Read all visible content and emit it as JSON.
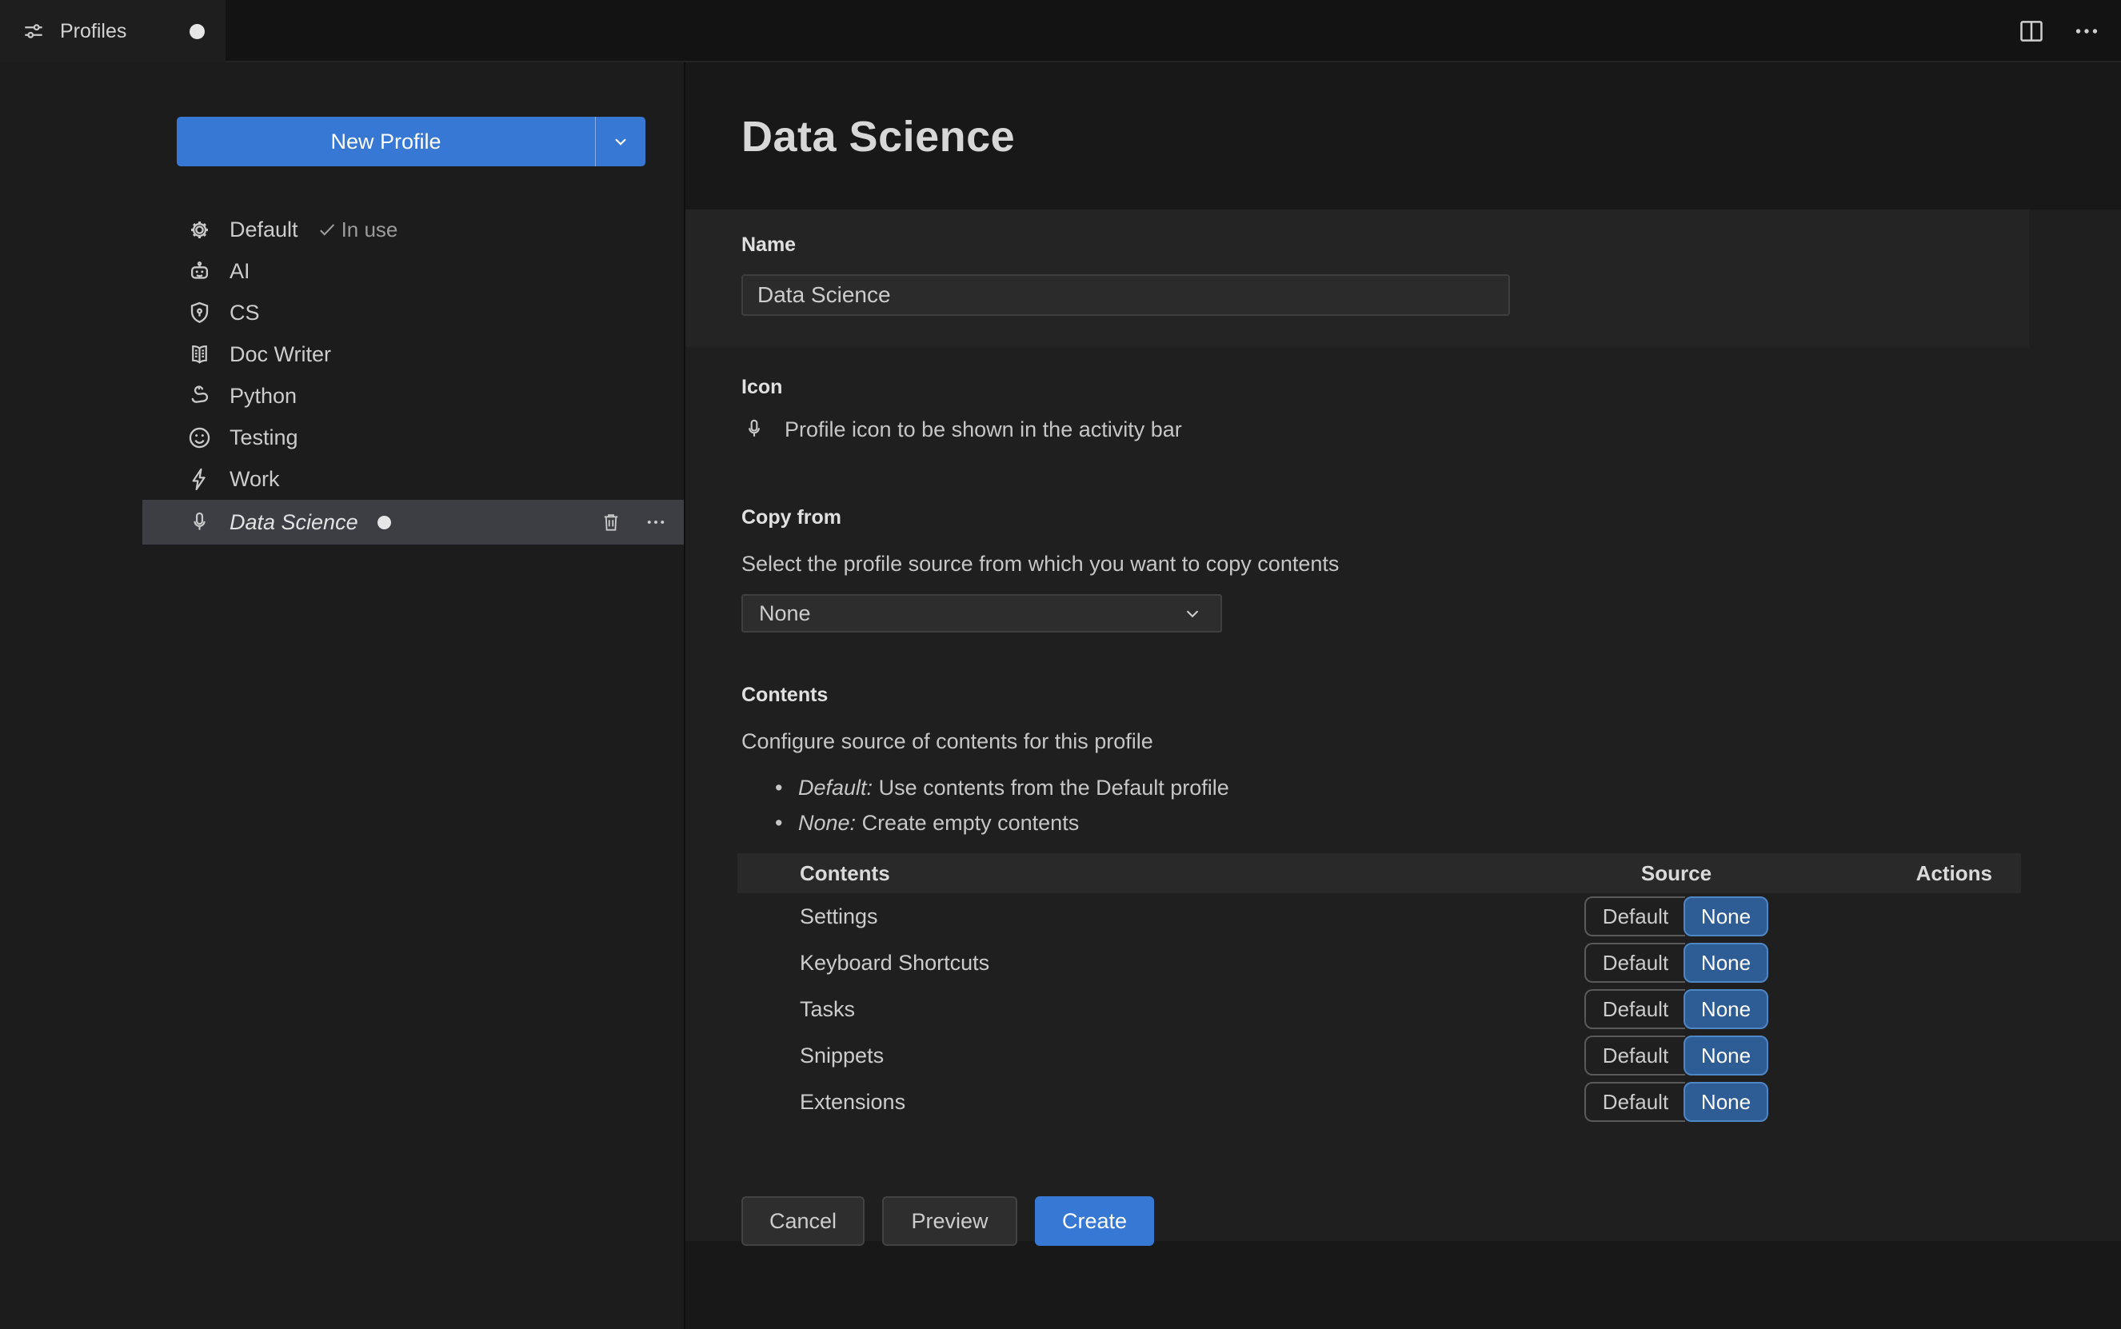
{
  "colors": {
    "accent_blue": "#3778d4",
    "toggle_selected_bg": "#2e5c95",
    "toggle_selected_border": "#4f86c5",
    "selected_row_bg": "#3d3d44",
    "panel_bg": "#1f1f1f",
    "editor_bg": "#181818"
  },
  "tab_bar": {
    "tab": {
      "label": "Profiles",
      "icon": "sliders",
      "modified": true
    },
    "actions": {
      "split_editor": "Split Editor",
      "more": "More Actions"
    }
  },
  "sidebar": {
    "new_profile_button": {
      "label": "New Profile",
      "has_dropdown": true
    },
    "profiles": [
      {
        "label": "Default",
        "icon": "gear",
        "badge": "In use"
      },
      {
        "label": "AI",
        "icon": "robot"
      },
      {
        "label": "CS",
        "icon": "shield"
      },
      {
        "label": "Doc Writer",
        "icon": "book"
      },
      {
        "label": "Python",
        "icon": "snake"
      },
      {
        "label": "Testing",
        "icon": "smiley"
      },
      {
        "label": "Work",
        "icon": "zap"
      },
      {
        "label": "Data Science",
        "icon": "microphone",
        "selected": true,
        "modified": true
      }
    ]
  },
  "main": {
    "title": "Data Science",
    "name_section": {
      "label": "Name",
      "value": "Data Science"
    },
    "icon_section": {
      "label": "Icon",
      "icon": "microphone",
      "description": "Profile icon to be shown in the activity bar"
    },
    "copy_from_section": {
      "label": "Copy from",
      "description": "Select the profile source from which you want to copy contents",
      "selected_option": "None"
    },
    "contents_section": {
      "label": "Contents",
      "description": "Configure source of contents for this profile",
      "bullet_marker": "•",
      "bullets": [
        {
          "term": "Default:",
          "text": " Use contents from the Default profile"
        },
        {
          "term": "None:",
          "text": " Create empty contents"
        }
      ],
      "table": {
        "headers": {
          "contents": "Contents",
          "source": "Source",
          "actions": "Actions"
        },
        "rows": [
          {
            "label": "Settings",
            "option_default": "Default",
            "option_none": "None",
            "selected": "None"
          },
          {
            "label": "Keyboard Shortcuts",
            "option_default": "Default",
            "option_none": "None",
            "selected": "None"
          },
          {
            "label": "Tasks",
            "option_default": "Default",
            "option_none": "None",
            "selected": "None"
          },
          {
            "label": "Snippets",
            "option_default": "Default",
            "option_none": "None",
            "selected": "None"
          },
          {
            "label": "Extensions",
            "option_default": "Default",
            "option_none": "None",
            "selected": "None"
          }
        ]
      }
    },
    "footer": {
      "cancel": "Cancel",
      "preview": "Preview",
      "create": "Create"
    }
  }
}
